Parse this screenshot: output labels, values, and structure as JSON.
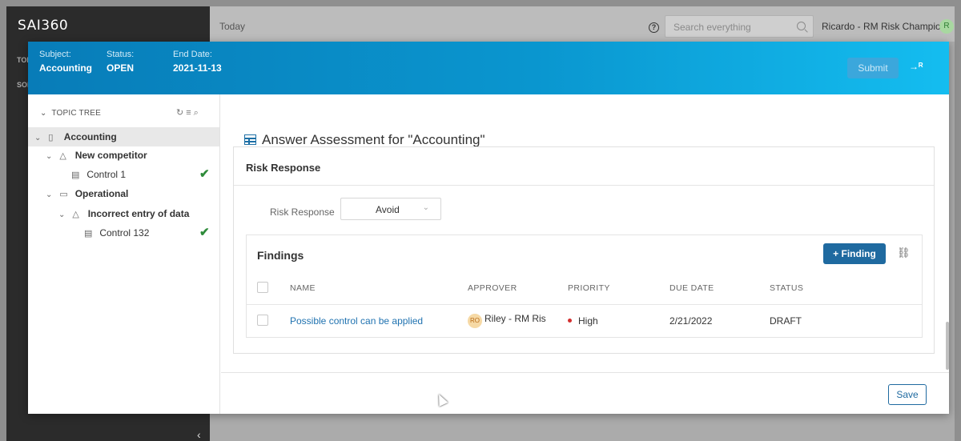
{
  "app": {
    "logo": "SAI360",
    "side_items": [
      "TOD",
      "SOL"
    ],
    "topbar_title": "Today",
    "search_placeholder": "Search everything",
    "user_name": "Ricardo - RM Risk Champion",
    "user_initial": "R",
    "collapse_glyph": "‹",
    "right_chevron": "›"
  },
  "modal": {
    "header": {
      "subject_label": "Subject:",
      "subject_value": "Accounting",
      "status_label": "Status:",
      "status_value": "OPEN",
      "end_date_label": "End Date:",
      "end_date_value": "2021-11-13",
      "submit_label": "Submit"
    },
    "tree": {
      "header": "TOPIC TREE",
      "items": [
        {
          "label": "Accounting",
          "bold": true,
          "selected": true,
          "icon": "document-icon"
        },
        {
          "label": "New competitor",
          "bold": true,
          "icon": "warning-icon"
        },
        {
          "label": "Control 1",
          "bold": false,
          "icon": "control-icon",
          "checked": true
        },
        {
          "label": "Operational",
          "bold": true,
          "icon": "folder-icon"
        },
        {
          "label": "Incorrect entry of data",
          "bold": true,
          "icon": "warning-icon"
        },
        {
          "label": "Control 132",
          "bold": false,
          "icon": "control-icon",
          "checked": true
        }
      ]
    },
    "content": {
      "title": "Answer Assessment for \"Accounting\"",
      "panel_title": "Risk Response",
      "risk_response_label": "Risk Response",
      "risk_response_value": "Avoid",
      "findings": {
        "title": "Findings",
        "add_label": "+ Finding",
        "columns": [
          "NAME",
          "APPROVER",
          "PRIORITY",
          "DUE DATE",
          "STATUS"
        ],
        "rows": [
          {
            "name": "Possible control can be applied",
            "approver_initials": "RO",
            "approver": "Riley - RM Ris",
            "priority": "High",
            "due_date": "2/21/2022",
            "status": "DRAFT"
          }
        ]
      },
      "save_label": "Save"
    }
  },
  "colors": {
    "header_start": "#087cb8",
    "header_end": "#14bdf0",
    "primary": "#1f6aa0",
    "success": "#2e8b3a",
    "priority_high": "#d32f2f"
  }
}
